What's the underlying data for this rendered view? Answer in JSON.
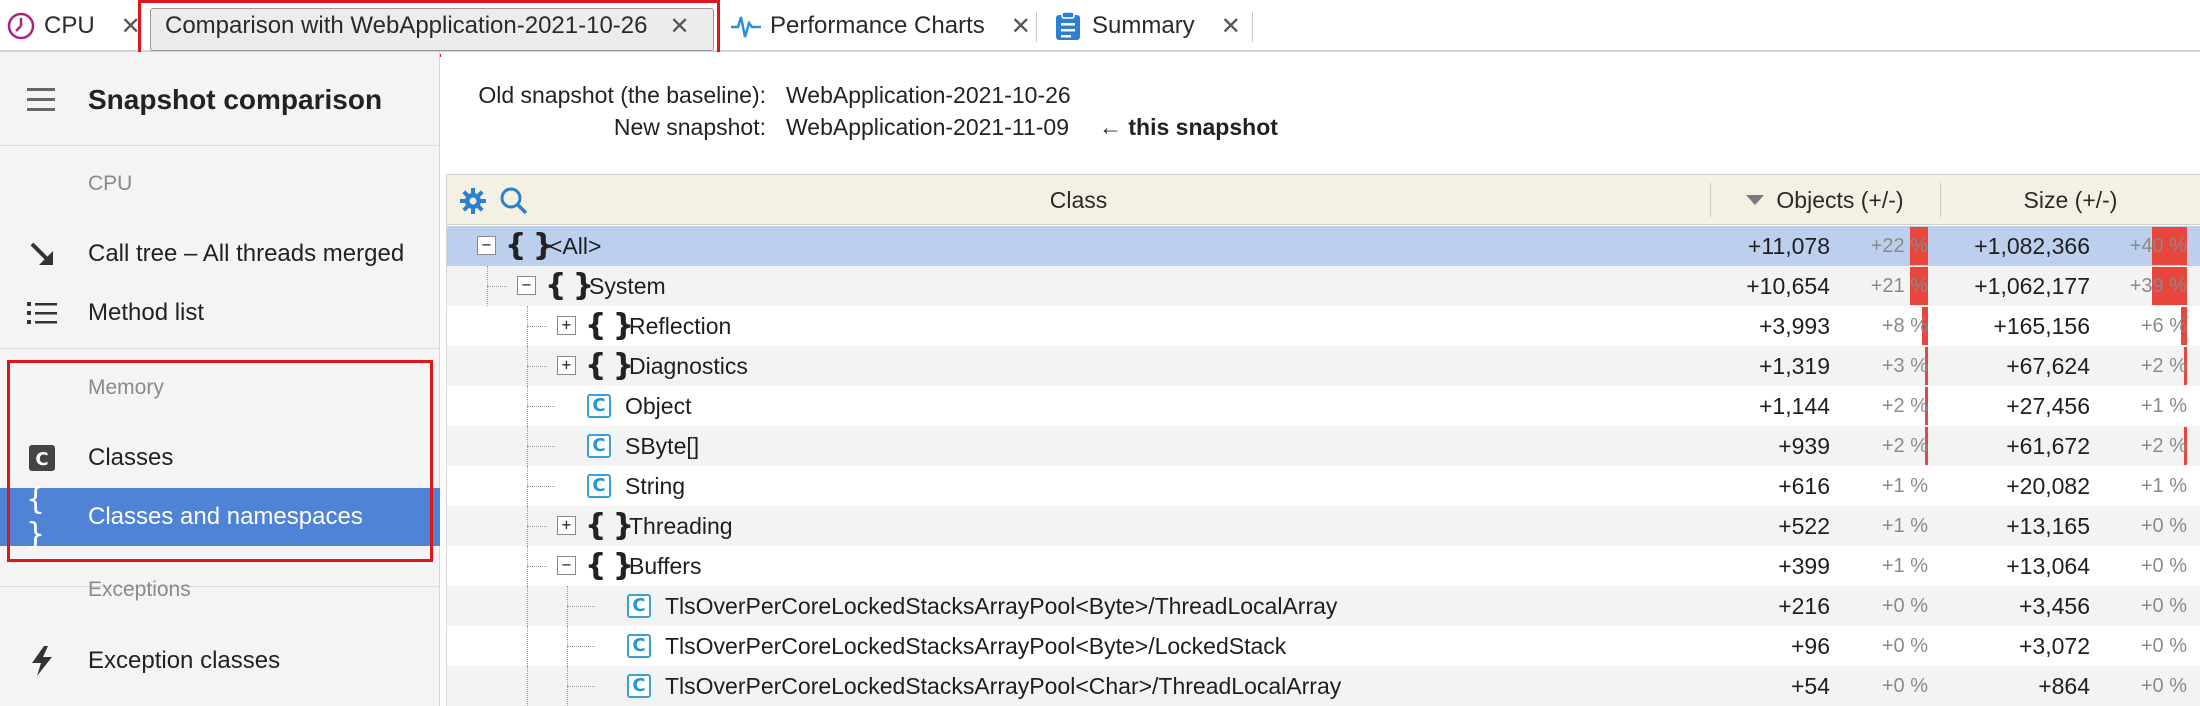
{
  "tabs": [
    {
      "label": "CPU",
      "icon": "cpu-clock-icon"
    },
    {
      "label": "Comparison with WebApplication-2021-10-26",
      "icon": ""
    },
    {
      "label": "Performance Charts",
      "icon": "performance-chart-icon"
    },
    {
      "label": "Summary",
      "icon": "clipboard-icon"
    }
  ],
  "tab_close_glyph": "✕",
  "sidebar": {
    "title": "Snapshot comparison",
    "sections": {
      "cpu": "CPU",
      "memory": "Memory",
      "exceptions": "Exceptions"
    },
    "items": {
      "call_tree": "Call tree – All threads merged",
      "method_list": "Method list",
      "classes": "Classes",
      "classes_ns": "Classes and namespaces",
      "exception_classes": "Exception classes"
    }
  },
  "snapshot": {
    "old_label": "Old snapshot (the baseline):",
    "old_value": "WebApplication-2021-10-26",
    "new_label": "New snapshot:",
    "new_value": "WebApplication-2021-11-09",
    "new_suffix": "← this snapshot"
  },
  "grid": {
    "col_class": "Class",
    "col_objects": "Objects (+/-)",
    "col_size": "Size (+/-)",
    "rows": [
      {
        "name": "<All>",
        "obj": "+11,078",
        "obj_pct": "+22 %",
        "obj_frac": 0.08,
        "size": "+1,082,366",
        "size_pct": "+40 %",
        "size_frac": 0.15
      },
      {
        "name": "System",
        "obj": "+10,654",
        "obj_pct": "+21 %",
        "obj_frac": 0.08,
        "size": "+1,062,177",
        "size_pct": "+39 %",
        "size_frac": 0.15
      },
      {
        "name": "Reflection",
        "obj": "+3,993",
        "obj_pct": "+8 %",
        "obj_frac": 0.025,
        "size": "+165,156",
        "size_pct": "+6 %",
        "size_frac": 0.025
      },
      {
        "name": "Diagnostics",
        "obj": "+1,319",
        "obj_pct": "+3 %",
        "obj_frac": 0.01,
        "size": "+67,624",
        "size_pct": "+2 %",
        "size_frac": 0.01
      },
      {
        "name": "Object",
        "obj": "+1,144",
        "obj_pct": "+2 %",
        "obj_frac": 0.008,
        "size": "+27,456",
        "size_pct": "+1 %",
        "size_frac": 0
      },
      {
        "name": "SByte[]",
        "obj": "+939",
        "obj_pct": "+2 %",
        "obj_frac": 0.008,
        "size": "+61,672",
        "size_pct": "+2 %",
        "size_frac": 0.008
      },
      {
        "name": "String",
        "obj": "+616",
        "obj_pct": "+1 %",
        "obj_frac": 0,
        "size": "+20,082",
        "size_pct": "+1 %",
        "size_frac": 0
      },
      {
        "name": "Threading",
        "obj": "+522",
        "obj_pct": "+1 %",
        "obj_frac": 0,
        "size": "+13,165",
        "size_pct": "+0 %",
        "size_frac": 0
      },
      {
        "name": "Buffers",
        "obj": "+399",
        "obj_pct": "+1 %",
        "obj_frac": 0,
        "size": "+13,064",
        "size_pct": "+0 %",
        "size_frac": 0
      },
      {
        "name": "TlsOverPerCoreLockedStacksArrayPool<Byte>/ThreadLocalArray",
        "obj": "+216",
        "obj_pct": "+0 %",
        "obj_frac": 0,
        "size": "+3,456",
        "size_pct": "+0 %",
        "size_frac": 0
      },
      {
        "name": "TlsOverPerCoreLockedStacksArrayPool<Byte>/LockedStack",
        "obj": "+96",
        "obj_pct": "+0 %",
        "obj_frac": 0,
        "size": "+3,072",
        "size_pct": "+0 %",
        "size_frac": 0
      },
      {
        "name": "TlsOverPerCoreLockedStacksArrayPool<Char>/ThreadLocalArray",
        "obj": "+54",
        "obj_pct": "+0 %",
        "obj_frac": 0,
        "size": "+864",
        "size_pct": "+0 %",
        "size_frac": 0
      }
    ]
  },
  "colors": {
    "accent": "#4e83d6",
    "highlight": "#e0151c",
    "bar": "#e8453c",
    "selected_row": "#bcd0ee"
  }
}
